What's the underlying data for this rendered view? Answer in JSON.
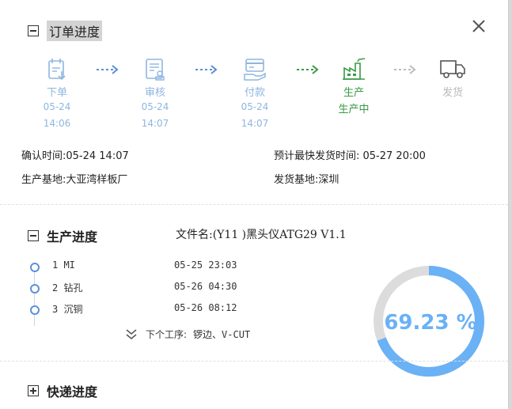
{
  "order": {
    "title": "订单进度",
    "steps": [
      {
        "label": "下单",
        "date": "05-24",
        "time": "14:06"
      },
      {
        "label": "审核",
        "date": "05-24",
        "time": "14:07"
      },
      {
        "label": "付款",
        "date": "05-24",
        "time": "14:07"
      },
      {
        "label": "生产",
        "status": "生产中"
      },
      {
        "label": "发货"
      }
    ],
    "confirm_time": "确认时间:05-24 14:07",
    "expected_ship": "预计最快发货时间: 05-27 20:00",
    "production_base": "生产基地:大亚湾样板厂",
    "ship_base": "发货基地:深圳"
  },
  "production": {
    "title": "生产进度",
    "file_name": "文件名:(Y11 )黑头仪ATG29 V1.1",
    "processes": [
      {
        "name": "1 MI",
        "time": "05-25 23:03"
      },
      {
        "name": "2 钻孔",
        "time": "05-26 04:30"
      },
      {
        "name": "3 沉铜",
        "time": "05-26 08:12"
      }
    ],
    "next_label": "下个工序:",
    "next_value": "锣边、V-CUT",
    "progress_text": "69.23 %",
    "progress_value": 0.6923
  },
  "express": {
    "title": "快递进度"
  },
  "colors": {
    "done": "#8fb6df",
    "active": "#3a9a45",
    "pending": "#b9b9b9",
    "ring": "#6ab1f5",
    "ring_bg": "#dcdcdc"
  }
}
